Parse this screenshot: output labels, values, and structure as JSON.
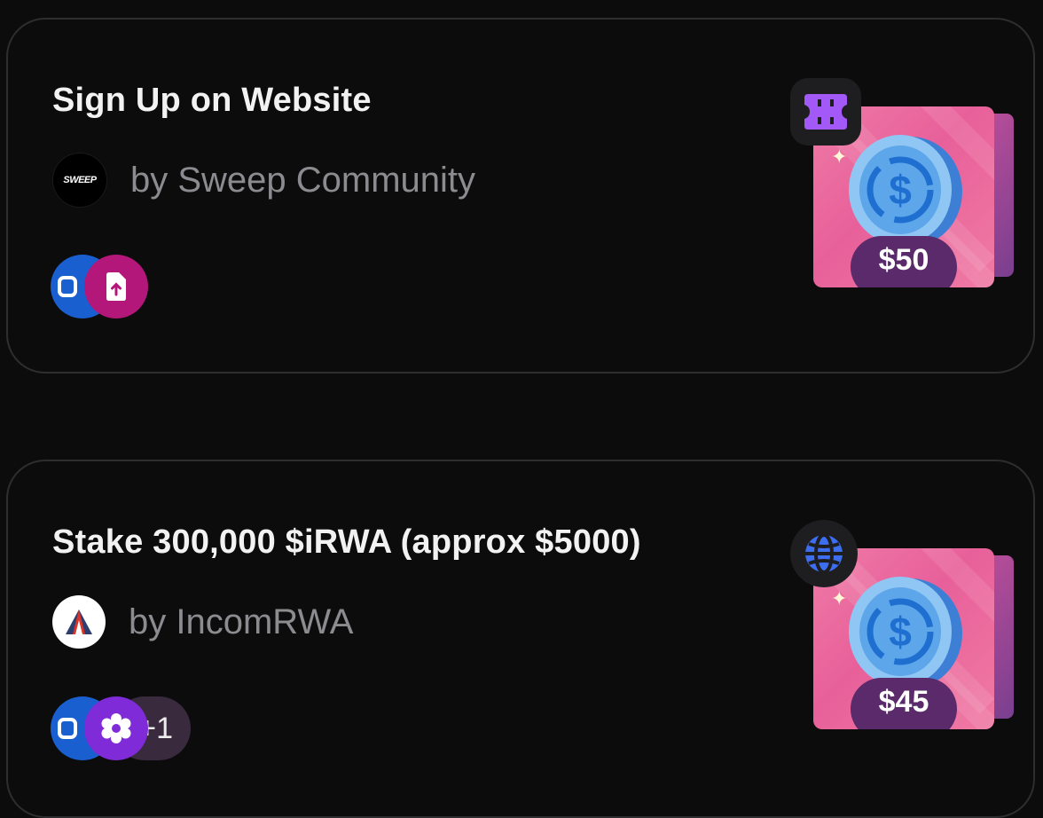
{
  "quests": [
    {
      "title": "Sign Up on Website",
      "author": "by Sweep Community",
      "author_avatar_text": "SWEEP",
      "reward": "$50",
      "task_icons": [
        "checkbox-icon",
        "file-upload-icon"
      ],
      "type_icon": "ticket-icon"
    },
    {
      "title": "Stake 300,000 $iRWA (approx $5000)",
      "author": "by IncomRWA",
      "reward": "$45",
      "task_icons": [
        "checkbox-icon",
        "gear-icon"
      ],
      "extra_count": "+1",
      "type_icon": "globe-icon"
    }
  ],
  "colors": {
    "background": "#0c0c0d",
    "card_border": "#2e2e31",
    "reward_pink": "#e8609a",
    "price_pill": "#5a2a6b",
    "badge_blue": "#1a5fd0",
    "badge_magenta": "#b4177a",
    "badge_purple": "#7f2bd8"
  }
}
